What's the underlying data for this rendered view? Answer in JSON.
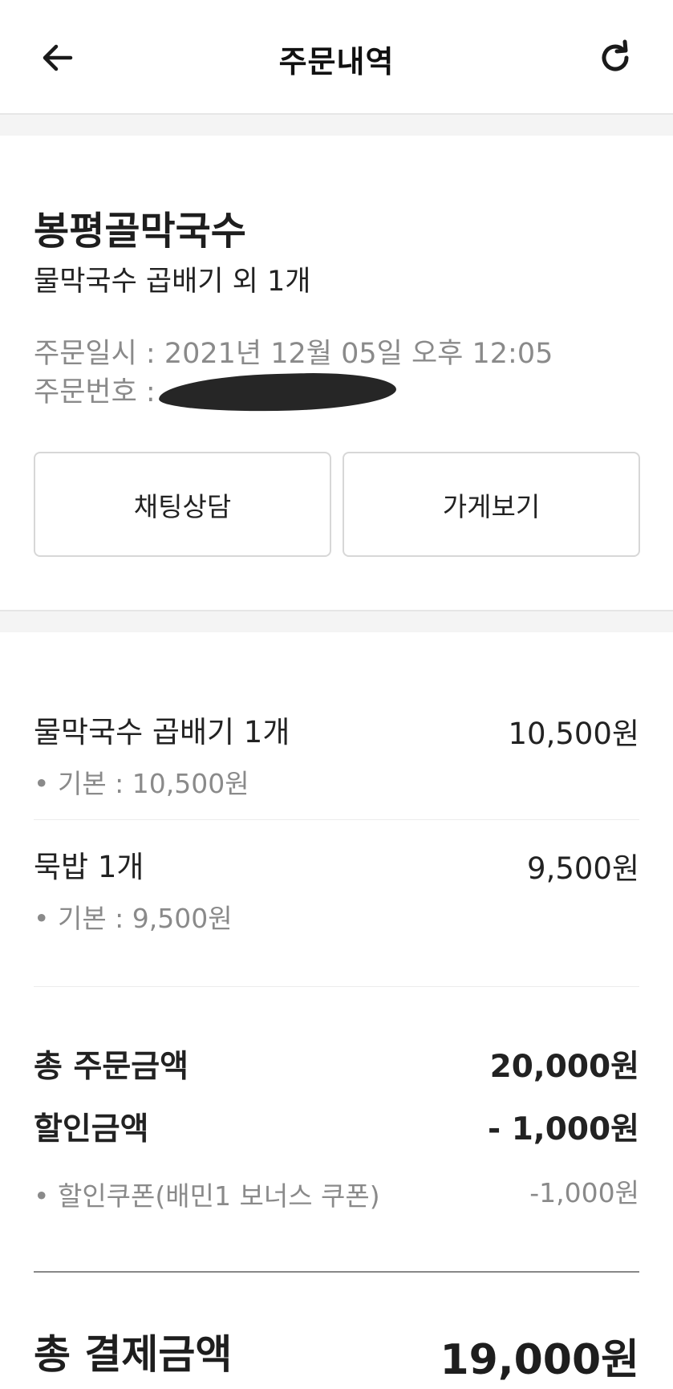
{
  "header": {
    "title": "주문내역",
    "back_icon": "arrow-left-icon",
    "refresh_icon": "refresh-icon"
  },
  "store": {
    "name": "봉평골막국수",
    "summary": "물막국수 곱배기 외 1개",
    "order_datetime": "주문일시 : 2021년 12월 05일 오후 12:05",
    "order_number_label": "주문번호 :"
  },
  "actions": {
    "chat_label": "채팅상담",
    "store_label": "가게보기"
  },
  "items": [
    {
      "name": "물막국수 곱배기 1개",
      "price": "10,500원",
      "option": "• 기본 : 10,500원"
    },
    {
      "name": "묵밥 1개",
      "price": "9,500원",
      "option": "• 기본 : 9,500원"
    }
  ],
  "summary": {
    "total_order_label": "총 주문금액",
    "total_order_value": "20,000원",
    "discount_label": "할인금액",
    "discount_value": "- 1,000원",
    "coupon_label": "• 할인쿠폰(배민1 보너스 쿠폰)",
    "coupon_value": "-1,000원",
    "total_payment_label": "총 결제금액",
    "total_payment_value": "19,000원"
  }
}
